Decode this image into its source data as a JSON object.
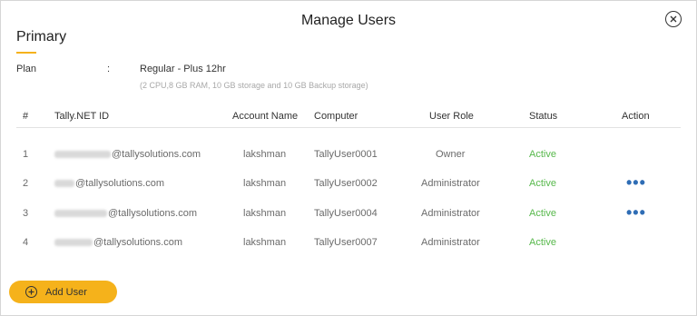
{
  "dialog": {
    "title": "Manage Users"
  },
  "section": {
    "title": "Primary"
  },
  "plan": {
    "label": "Plan",
    "separator": ":",
    "value": "Regular - Plus 12hr",
    "description": "(2 CPU,8 GB RAM, 10 GB storage and 10 GB Backup storage)"
  },
  "table": {
    "headers": {
      "num": "#",
      "id": "Tally.NET ID",
      "account": "Account Name",
      "computer": "Computer",
      "role": "User Role",
      "status": "Status",
      "action": "Action"
    },
    "rows": [
      {
        "num": "1",
        "id_domain": "@tallysolutions.com",
        "account": "lakshman",
        "computer": "TallyUser0001",
        "role": "Owner",
        "status": "Active",
        "action": ""
      },
      {
        "num": "2",
        "id_domain": "@tallysolutions.com",
        "account": "lakshman",
        "computer": "TallyUser0002",
        "role": "Administrator",
        "status": "Active",
        "action": "•••"
      },
      {
        "num": "3",
        "id_domain": "@tallysolutions.com",
        "account": "lakshman",
        "computer": "TallyUser0004",
        "role": "Administrator",
        "status": "Active",
        "action": "•••"
      },
      {
        "num": "4",
        "id_domain": "@tallysolutions.com",
        "account": "lakshman",
        "computer": "TallyUser0007",
        "role": "Administrator",
        "status": "Active",
        "action": ""
      }
    ]
  },
  "buttons": {
    "add_user": "Add User"
  },
  "colors": {
    "accent": "#f5b21b",
    "status_active": "#57b84b",
    "action_dots": "#2f6db5"
  }
}
